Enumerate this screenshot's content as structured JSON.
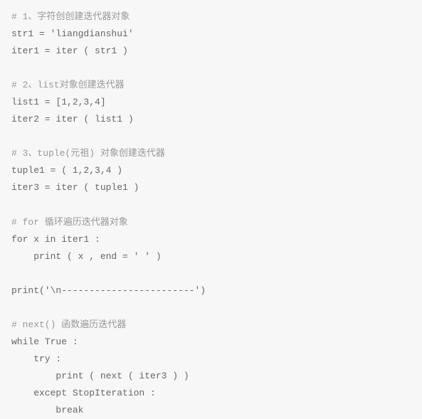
{
  "code": {
    "lines": [
      {
        "type": "comment",
        "text": "# 1、字符创创建迭代器对象"
      },
      {
        "type": "code",
        "text": "str1 = 'liangdianshui'"
      },
      {
        "type": "code",
        "text": "iter1 = iter ( str1 )"
      },
      {
        "type": "blank",
        "text": ""
      },
      {
        "type": "comment",
        "text": "# 2、list对象创建迭代器"
      },
      {
        "type": "code",
        "text": "list1 = [1,2,3,4]"
      },
      {
        "type": "code",
        "text": "iter2 = iter ( list1 )"
      },
      {
        "type": "blank",
        "text": ""
      },
      {
        "type": "comment",
        "text": "# 3、tuple(元祖) 对象创建迭代器"
      },
      {
        "type": "code",
        "text": "tuple1 = ( 1,2,3,4 )"
      },
      {
        "type": "code",
        "text": "iter3 = iter ( tuple1 )"
      },
      {
        "type": "blank",
        "text": ""
      },
      {
        "type": "comment",
        "text": "# for 循环遍历迭代器对象"
      },
      {
        "type": "code",
        "text": "for x in iter1 :"
      },
      {
        "type": "code",
        "text": "    print ( x , end = ' ' )"
      },
      {
        "type": "blank",
        "text": ""
      },
      {
        "type": "code",
        "text": "print('\\n------------------------')"
      },
      {
        "type": "blank",
        "text": ""
      },
      {
        "type": "comment",
        "text": "# next() 函数遍历迭代器"
      },
      {
        "type": "code",
        "text": "while True :"
      },
      {
        "type": "code",
        "text": "    try :"
      },
      {
        "type": "code",
        "text": "        print ( next ( iter3 ) )"
      },
      {
        "type": "code",
        "text": "    except StopIteration :"
      },
      {
        "type": "code",
        "text": "        break"
      }
    ]
  }
}
